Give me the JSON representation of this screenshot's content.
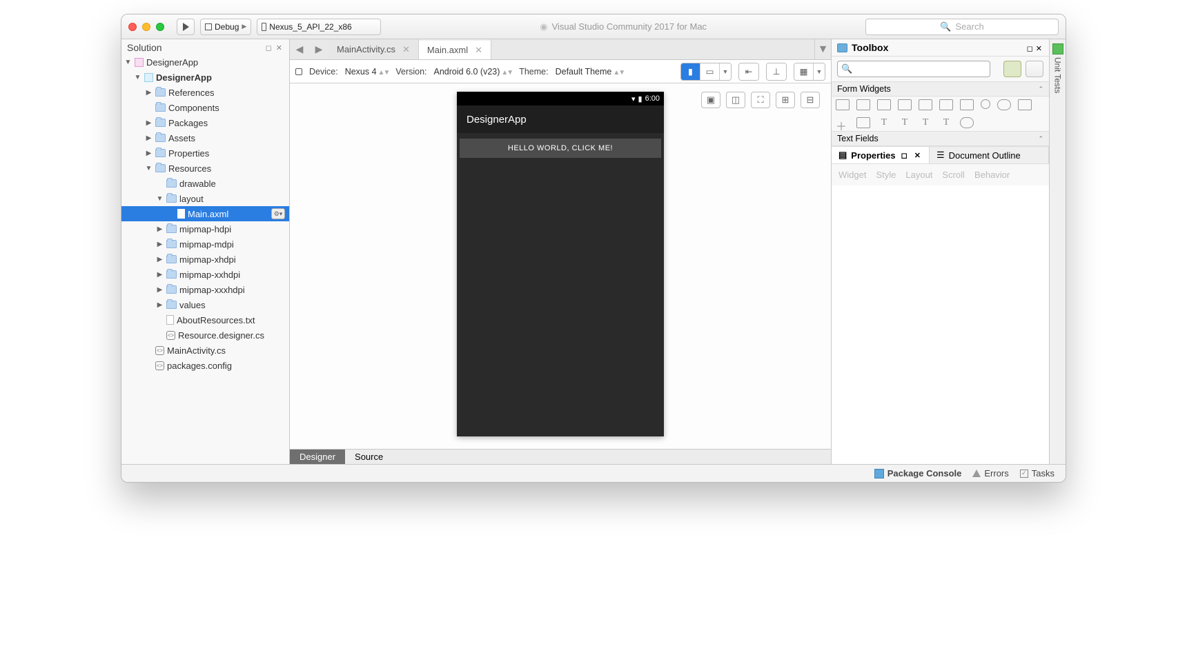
{
  "titlebar": {
    "config": "Debug",
    "target": "Nexus_5_API_22_x86",
    "product": "Visual Studio Community 2017 for Mac",
    "search_placeholder": "Search"
  },
  "solution": {
    "title": "Solution",
    "root": "DesignerApp",
    "project": "DesignerApp",
    "nodes": {
      "references": "References",
      "components": "Components",
      "packages": "Packages",
      "assets": "Assets",
      "properties": "Properties",
      "resources": "Resources",
      "drawable": "drawable",
      "layout": "layout",
      "main_axml": "Main.axml",
      "mip_h": "mipmap-hdpi",
      "mip_m": "mipmap-mdpi",
      "mip_xh": "mipmap-xhdpi",
      "mip_xxh": "mipmap-xxhdpi",
      "mip_xxxh": "mipmap-xxxhdpi",
      "values": "values",
      "about_res": "AboutResources.txt",
      "res_designer": "Resource.designer.cs",
      "main_activity": "MainActivity.cs",
      "pkg_config": "packages.config"
    }
  },
  "editor": {
    "tabs": [
      {
        "label": "MainActivity.cs",
        "active": false
      },
      {
        "label": "Main.axml",
        "active": true
      }
    ],
    "device_label": "Device:",
    "device_value": "Nexus 4",
    "version_label": "Version:",
    "version_value": "Android 6.0 (v23)",
    "theme_label": "Theme:",
    "theme_value": "Default Theme",
    "bottom_tabs": {
      "designer": "Designer",
      "source": "Source"
    }
  },
  "phone": {
    "time": "6:00",
    "app_title": "DesignerApp",
    "button_text": "HELLO WORLD, CLICK ME!"
  },
  "toolbox": {
    "title": "Toolbox",
    "search_ph": "",
    "sections": {
      "form_widgets": "Form Widgets",
      "text_fields": "Text Fields"
    },
    "subtabs": {
      "properties": "Properties",
      "document_outline": "Document Outline"
    },
    "prop_cats": [
      "Widget",
      "Style",
      "Layout",
      "Scroll",
      "Behavior"
    ]
  },
  "right_side_label": "Unit Tests",
  "status": {
    "package_console": "Package Console",
    "errors": "Errors",
    "tasks": "Tasks"
  }
}
